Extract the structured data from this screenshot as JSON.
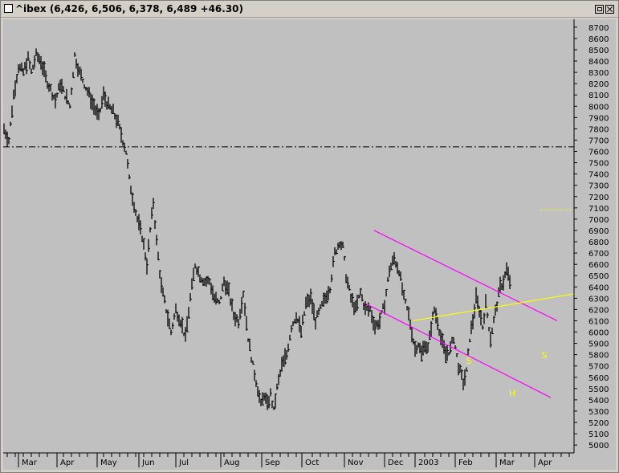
{
  "window": {
    "title": "^ibex (6,426, 6,506, 6,378, 6,489 +46.30)",
    "restore_button": "restore",
    "close_button": "close"
  },
  "colors": {
    "plot_background": "#c0c0c0",
    "price_bars": "#000000",
    "channel_lines": "#ff00ff",
    "neckline": "#ffff00",
    "labels": "#ffff00"
  },
  "chart_data": {
    "type": "bar",
    "subtype": "ohlc_price_bars",
    "title": "^ibex (6,426, 6,506, 6,378, 6,489 +46.30)",
    "last_bar": {
      "open": 6426,
      "high": 6506,
      "low": 6378,
      "close": 6489,
      "change": 46.3
    },
    "y_axis": {
      "position": "right",
      "range": [
        4930,
        8770
      ],
      "ticks": [
        8700,
        8600,
        8500,
        8400,
        8300,
        8200,
        8100,
        8000,
        7900,
        7800,
        7700,
        7600,
        7500,
        7400,
        7300,
        7200,
        7100,
        7000,
        6900,
        6800,
        6700,
        6600,
        6500,
        6400,
        6300,
        6200,
        6100,
        6000,
        5900,
        5800,
        5700,
        5600,
        5500,
        5400,
        5300,
        5200,
        5100,
        5000
      ]
    },
    "x_axis": {
      "labels": [
        "Mar",
        "Apr",
        "May",
        "Jun",
        "Jul",
        "Aug",
        "Sep",
        "Oct",
        "Nov",
        "Dec",
        "2003",
        "Feb",
        "Mar",
        "Apr"
      ]
    },
    "grid": false,
    "price_path": [
      [
        0,
        7800
      ],
      [
        6,
        7700
      ],
      [
        12,
        8100
      ],
      [
        18,
        8350
      ],
      [
        24,
        8300
      ],
      [
        30,
        8420
      ],
      [
        34,
        8300
      ],
      [
        40,
        8450
      ],
      [
        46,
        8400
      ],
      [
        52,
        8250
      ],
      [
        58,
        8150
      ],
      [
        64,
        8050
      ],
      [
        70,
        8200
      ],
      [
        76,
        8100
      ],
      [
        82,
        8000
      ],
      [
        88,
        8450
      ],
      [
        94,
        8300
      ],
      [
        100,
        8200
      ],
      [
        106,
        8100
      ],
      [
        112,
        8000
      ],
      [
        118,
        7900
      ],
      [
        124,
        8100
      ],
      [
        130,
        8000
      ],
      [
        136,
        7950
      ],
      [
        142,
        7850
      ],
      [
        148,
        7700
      ],
      [
        152,
        7600
      ],
      [
        156,
        7350
      ],
      [
        160,
        7200
      ],
      [
        166,
        7000
      ],
      [
        172,
        6850
      ],
      [
        178,
        6600
      ],
      [
        182,
        6900
      ],
      [
        186,
        7150
      ],
      [
        190,
        6800
      ],
      [
        196,
        6400
      ],
      [
        202,
        6200
      ],
      [
        208,
        6000
      ],
      [
        214,
        6200
      ],
      [
        220,
        6100
      ],
      [
        226,
        5950
      ],
      [
        232,
        6300
      ],
      [
        238,
        6600
      ],
      [
        244,
        6500
      ],
      [
        250,
        6450
      ],
      [
        256,
        6450
      ],
      [
        262,
        6300
      ],
      [
        268,
        6250
      ],
      [
        274,
        6450
      ],
      [
        280,
        6350
      ],
      [
        286,
        6150
      ],
      [
        292,
        6100
      ],
      [
        298,
        6350
      ],
      [
        304,
        5950
      ],
      [
        310,
        5700
      ],
      [
        316,
        5500
      ],
      [
        320,
        5350
      ],
      [
        324,
        5450
      ],
      [
        328,
        5350
      ],
      [
        332,
        5450
      ],
      [
        336,
        5300
      ],
      [
        340,
        5500
      ],
      [
        346,
        5700
      ],
      [
        352,
        5800
      ],
      [
        358,
        6050
      ],
      [
        364,
        6150
      ],
      [
        370,
        6000
      ],
      [
        376,
        6250
      ],
      [
        382,
        6300
      ],
      [
        388,
        6100
      ],
      [
        394,
        6200
      ],
      [
        400,
        6300
      ],
      [
        406,
        6400
      ],
      [
        412,
        6700
      ],
      [
        418,
        6800
      ],
      [
        422,
        6750
      ],
      [
        426,
        6500
      ],
      [
        432,
        6300
      ],
      [
        438,
        6200
      ],
      [
        444,
        6350
      ],
      [
        450,
        6200
      ],
      [
        456,
        6200
      ],
      [
        462,
        6050
      ],
      [
        468,
        6100
      ],
      [
        474,
        6250
      ],
      [
        480,
        6550
      ],
      [
        486,
        6650
      ],
      [
        492,
        6550
      ],
      [
        498,
        6300
      ],
      [
        504,
        6150
      ],
      [
        508,
        6000
      ],
      [
        512,
        5850
      ],
      [
        516,
        5900
      ],
      [
        520,
        5800
      ],
      [
        524,
        5900
      ],
      [
        528,
        5850
      ],
      [
        532,
        6050
      ],
      [
        536,
        6200
      ],
      [
        540,
        6100
      ],
      [
        544,
        5950
      ],
      [
        550,
        5800
      ],
      [
        556,
        5850
      ],
      [
        560,
        5950
      ],
      [
        566,
        5700
      ],
      [
        572,
        5550
      ],
      [
        576,
        5650
      ],
      [
        580,
        5950
      ],
      [
        584,
        6100
      ],
      [
        588,
        6300
      ],
      [
        592,
        6200
      ],
      [
        596,
        6050
      ],
      [
        600,
        6250
      ],
      [
        606,
        5950
      ],
      [
        610,
        6100
      ],
      [
        614,
        6250
      ],
      [
        618,
        6400
      ],
      [
        622,
        6450
      ],
      [
        626,
        6550
      ],
      [
        630,
        6450
      ]
    ],
    "annotations": {
      "resistance_level": 7640,
      "dashed_level": 7080,
      "channel_upper": {
        "from": {
          "x_index": 462,
          "price": 6900
        },
        "to": {
          "x_index": 690,
          "price": 6100
        }
      },
      "channel_lower": {
        "from": {
          "x_index": 452,
          "price": 6250
        },
        "to": {
          "x_index": 682,
          "price": 5420
        }
      },
      "neckline": {
        "from": {
          "x_index": 510,
          "price": 6100
        },
        "to": {
          "x_index": 712,
          "price": 6340
        }
      },
      "pattern_labels": [
        {
          "text": "S",
          "x_index": 580,
          "price": 5720
        },
        {
          "text": "H",
          "x_index": 634,
          "price": 5430
        },
        {
          "text": "S",
          "x_index": 674,
          "price": 5770
        }
      ]
    }
  }
}
